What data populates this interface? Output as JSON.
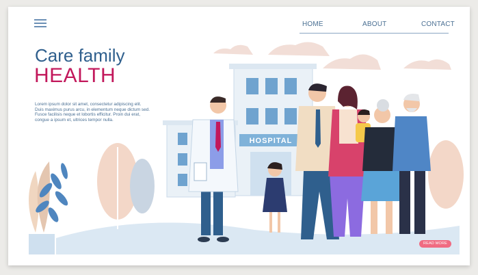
{
  "nav": {
    "items": [
      {
        "label": "HOME"
      },
      {
        "label": "ABOUT"
      },
      {
        "label": "CONTACT"
      }
    ]
  },
  "hero": {
    "title_line1": "Care family",
    "title_line2": "HEALTH",
    "body_lines": [
      "Lorem ipsum dolor sit amet, consectetur adipiscing elit.",
      "Duis maximus purus arcu, in elementum neque dictum sed.",
      "Fusce facilisis neque et lobortis efficitur. Proin dui erat,",
      "congue a ipsum et, ultrices tempor nulla."
    ],
    "cta_label": "READ MORE"
  },
  "illustration": {
    "building_sign": "HOSPITAL"
  },
  "colors": {
    "title_blue": "#2f5f8d",
    "title_pink": "#c2185b",
    "cta": "#f06b82",
    "nav_text": "#4a6f93"
  }
}
